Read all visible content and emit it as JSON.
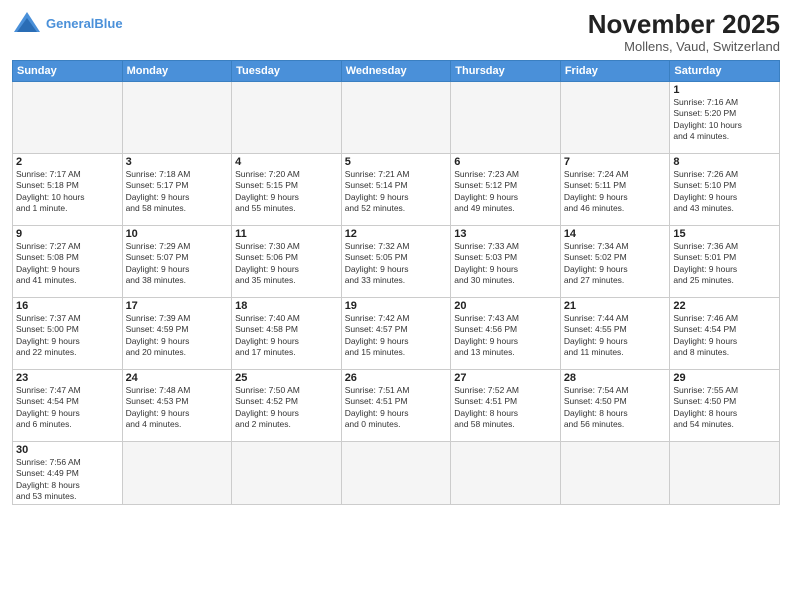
{
  "header": {
    "logo_general": "General",
    "logo_blue": "Blue",
    "month_year": "November 2025",
    "location": "Mollens, Vaud, Switzerland"
  },
  "days_of_week": [
    "Sunday",
    "Monday",
    "Tuesday",
    "Wednesday",
    "Thursday",
    "Friday",
    "Saturday"
  ],
  "weeks": [
    [
      {
        "day": "",
        "info": ""
      },
      {
        "day": "",
        "info": ""
      },
      {
        "day": "",
        "info": ""
      },
      {
        "day": "",
        "info": ""
      },
      {
        "day": "",
        "info": ""
      },
      {
        "day": "",
        "info": ""
      },
      {
        "day": "1",
        "info": "Sunrise: 7:16 AM\nSunset: 5:20 PM\nDaylight: 10 hours\nand 4 minutes."
      }
    ],
    [
      {
        "day": "2",
        "info": "Sunrise: 7:17 AM\nSunset: 5:18 PM\nDaylight: 10 hours\nand 1 minute."
      },
      {
        "day": "3",
        "info": "Sunrise: 7:18 AM\nSunset: 5:17 PM\nDaylight: 9 hours\nand 58 minutes."
      },
      {
        "day": "4",
        "info": "Sunrise: 7:20 AM\nSunset: 5:15 PM\nDaylight: 9 hours\nand 55 minutes."
      },
      {
        "day": "5",
        "info": "Sunrise: 7:21 AM\nSunset: 5:14 PM\nDaylight: 9 hours\nand 52 minutes."
      },
      {
        "day": "6",
        "info": "Sunrise: 7:23 AM\nSunset: 5:12 PM\nDaylight: 9 hours\nand 49 minutes."
      },
      {
        "day": "7",
        "info": "Sunrise: 7:24 AM\nSunset: 5:11 PM\nDaylight: 9 hours\nand 46 minutes."
      },
      {
        "day": "8",
        "info": "Sunrise: 7:26 AM\nSunset: 5:10 PM\nDaylight: 9 hours\nand 43 minutes."
      }
    ],
    [
      {
        "day": "9",
        "info": "Sunrise: 7:27 AM\nSunset: 5:08 PM\nDaylight: 9 hours\nand 41 minutes."
      },
      {
        "day": "10",
        "info": "Sunrise: 7:29 AM\nSunset: 5:07 PM\nDaylight: 9 hours\nand 38 minutes."
      },
      {
        "day": "11",
        "info": "Sunrise: 7:30 AM\nSunset: 5:06 PM\nDaylight: 9 hours\nand 35 minutes."
      },
      {
        "day": "12",
        "info": "Sunrise: 7:32 AM\nSunset: 5:05 PM\nDaylight: 9 hours\nand 33 minutes."
      },
      {
        "day": "13",
        "info": "Sunrise: 7:33 AM\nSunset: 5:03 PM\nDaylight: 9 hours\nand 30 minutes."
      },
      {
        "day": "14",
        "info": "Sunrise: 7:34 AM\nSunset: 5:02 PM\nDaylight: 9 hours\nand 27 minutes."
      },
      {
        "day": "15",
        "info": "Sunrise: 7:36 AM\nSunset: 5:01 PM\nDaylight: 9 hours\nand 25 minutes."
      }
    ],
    [
      {
        "day": "16",
        "info": "Sunrise: 7:37 AM\nSunset: 5:00 PM\nDaylight: 9 hours\nand 22 minutes."
      },
      {
        "day": "17",
        "info": "Sunrise: 7:39 AM\nSunset: 4:59 PM\nDaylight: 9 hours\nand 20 minutes."
      },
      {
        "day": "18",
        "info": "Sunrise: 7:40 AM\nSunset: 4:58 PM\nDaylight: 9 hours\nand 17 minutes."
      },
      {
        "day": "19",
        "info": "Sunrise: 7:42 AM\nSunset: 4:57 PM\nDaylight: 9 hours\nand 15 minutes."
      },
      {
        "day": "20",
        "info": "Sunrise: 7:43 AM\nSunset: 4:56 PM\nDaylight: 9 hours\nand 13 minutes."
      },
      {
        "day": "21",
        "info": "Sunrise: 7:44 AM\nSunset: 4:55 PM\nDaylight: 9 hours\nand 11 minutes."
      },
      {
        "day": "22",
        "info": "Sunrise: 7:46 AM\nSunset: 4:54 PM\nDaylight: 9 hours\nand 8 minutes."
      }
    ],
    [
      {
        "day": "23",
        "info": "Sunrise: 7:47 AM\nSunset: 4:54 PM\nDaylight: 9 hours\nand 6 minutes."
      },
      {
        "day": "24",
        "info": "Sunrise: 7:48 AM\nSunset: 4:53 PM\nDaylight: 9 hours\nand 4 minutes."
      },
      {
        "day": "25",
        "info": "Sunrise: 7:50 AM\nSunset: 4:52 PM\nDaylight: 9 hours\nand 2 minutes."
      },
      {
        "day": "26",
        "info": "Sunrise: 7:51 AM\nSunset: 4:51 PM\nDaylight: 9 hours\nand 0 minutes."
      },
      {
        "day": "27",
        "info": "Sunrise: 7:52 AM\nSunset: 4:51 PM\nDaylight: 8 hours\nand 58 minutes."
      },
      {
        "day": "28",
        "info": "Sunrise: 7:54 AM\nSunset: 4:50 PM\nDaylight: 8 hours\nand 56 minutes."
      },
      {
        "day": "29",
        "info": "Sunrise: 7:55 AM\nSunset: 4:50 PM\nDaylight: 8 hours\nand 54 minutes."
      }
    ],
    [
      {
        "day": "30",
        "info": "Sunrise: 7:56 AM\nSunset: 4:49 PM\nDaylight: 8 hours\nand 53 minutes."
      },
      {
        "day": "",
        "info": ""
      },
      {
        "day": "",
        "info": ""
      },
      {
        "day": "",
        "info": ""
      },
      {
        "day": "",
        "info": ""
      },
      {
        "day": "",
        "info": ""
      },
      {
        "day": "",
        "info": ""
      }
    ]
  ]
}
